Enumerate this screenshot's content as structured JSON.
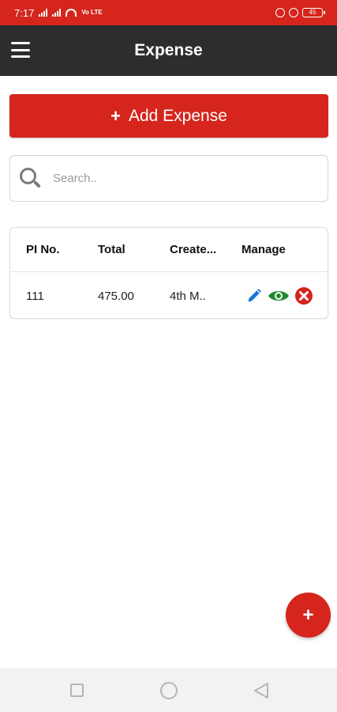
{
  "status_bar": {
    "time": "7:17",
    "volte": "Vo LTE",
    "battery": "45"
  },
  "app_bar": {
    "title": "Expense",
    "menu_icon": "hamburger-menu-icon"
  },
  "add_button": {
    "icon": "plus-icon",
    "label": "Add Expense"
  },
  "search": {
    "icon": "search-icon",
    "placeholder": "Search..",
    "value": ""
  },
  "table": {
    "columns": [
      "PI No.",
      "Total",
      "Create...",
      "Manage"
    ],
    "rows": [
      {
        "pi_no": "111",
        "total": "475.00",
        "created": "4th M..",
        "actions": [
          "edit-icon",
          "view-icon",
          "delete-icon"
        ]
      }
    ]
  },
  "fab": {
    "icon": "plus-icon",
    "label": "+"
  },
  "colors": {
    "primary": "#d5251c",
    "app_bar": "#2b2d2f",
    "edit": "#1976d2",
    "view": "#1e8a2e",
    "delete": "#d5251c"
  },
  "nav_bar": {
    "icons": [
      "recent-apps-icon",
      "home-icon",
      "back-icon"
    ]
  }
}
